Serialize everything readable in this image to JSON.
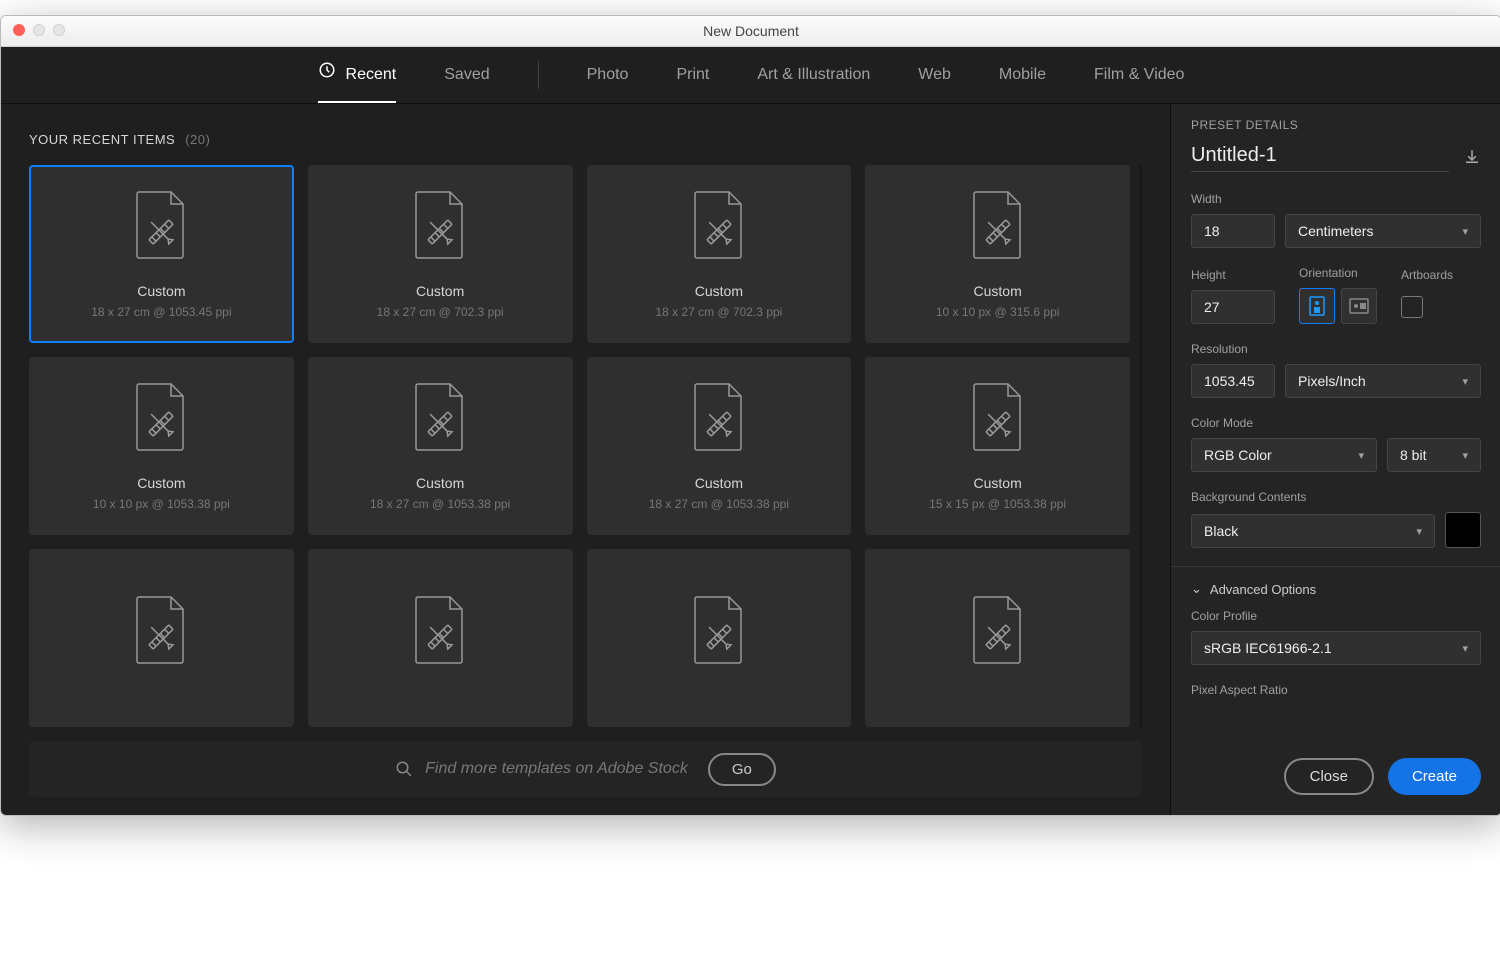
{
  "window": {
    "title": "New Document"
  },
  "tabs": [
    {
      "id": "recent",
      "label": "Recent",
      "active": true,
      "hasIcon": true
    },
    {
      "id": "saved",
      "label": "Saved"
    },
    {
      "sep": true
    },
    {
      "id": "photo",
      "label": "Photo"
    },
    {
      "id": "print",
      "label": "Print"
    },
    {
      "id": "art",
      "label": "Art & Illustration"
    },
    {
      "id": "web",
      "label": "Web"
    },
    {
      "id": "mobile",
      "label": "Mobile"
    },
    {
      "id": "film",
      "label": "Film & Video"
    }
  ],
  "section": {
    "title": "YOUR RECENT ITEMS",
    "count": "(20)"
  },
  "tiles": [
    {
      "label": "Custom",
      "meta": "18 x 27 cm @ 1053.45 ppi",
      "selected": true
    },
    {
      "label": "Custom",
      "meta": "18 x 27 cm @ 702.3 ppi"
    },
    {
      "label": "Custom",
      "meta": "18 x 27 cm @ 702.3 ppi"
    },
    {
      "label": "Custom",
      "meta": "10 x 10 px @ 315.6 ppi"
    },
    {
      "label": "Custom",
      "meta": "10 x 10 px @ 1053.38 ppi"
    },
    {
      "label": "Custom",
      "meta": "18 x 27 cm @ 1053.38 ppi"
    },
    {
      "label": "Custom",
      "meta": "18 x 27 cm @ 1053.38 ppi"
    },
    {
      "label": "Custom",
      "meta": "15 x 15 px @ 1053.38 ppi"
    },
    {
      "label": "",
      "meta": ""
    },
    {
      "label": "",
      "meta": ""
    },
    {
      "label": "",
      "meta": ""
    },
    {
      "label": "",
      "meta": ""
    }
  ],
  "search": {
    "placeholder": "Find more templates on Adobe Stock",
    "go": "Go"
  },
  "details": {
    "header": "PRESET DETAILS",
    "name": "Untitled-1",
    "width_label": "Width",
    "width_value": "18",
    "units": "Centimeters",
    "height_label": "Height",
    "height_value": "27",
    "orientation_label": "Orientation",
    "artboards_label": "Artboards",
    "resolution_label": "Resolution",
    "resolution_value": "1053.45",
    "resolution_units": "Pixels/Inch",
    "colormode_label": "Color Mode",
    "colormode_value": "RGB Color",
    "bitdepth": "8 bit",
    "bg_label": "Background Contents",
    "bg_value": "Black",
    "advanced_label": "Advanced Options",
    "profile_label": "Color Profile",
    "profile_value": "sRGB IEC61966-2.1",
    "par_label": "Pixel Aspect Ratio"
  },
  "footer": {
    "close": "Close",
    "create": "Create"
  }
}
